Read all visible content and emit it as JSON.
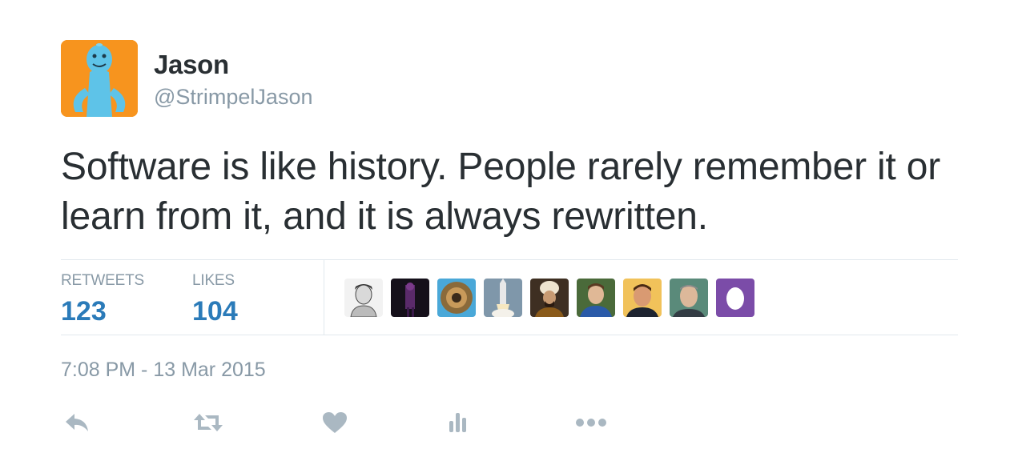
{
  "author": {
    "display_name": "Jason",
    "handle": "@StrimpelJason",
    "avatar_icon": "meeseeks-avatar"
  },
  "tweet": {
    "text": "Software is like history. People rarely remember it or learn from it, and it is always rewritten.",
    "timestamp": "7:08 PM - 13 Mar 2015"
  },
  "stats": {
    "retweets_label": "RETWEETS",
    "retweets_count": "123",
    "likes_label": "LIKES",
    "likes_count": "104"
  },
  "likers": [
    {
      "icon": "sketch-portrait-avatar"
    },
    {
      "icon": "dark-concert-avatar"
    },
    {
      "icon": "fisheye-photo-avatar"
    },
    {
      "icon": "rocket-launch-avatar"
    },
    {
      "icon": "ottoman-portrait-avatar"
    },
    {
      "icon": "man-blue-shirt-avatar"
    },
    {
      "icon": "man-yellow-bg-avatar"
    },
    {
      "icon": "man-outdoor-avatar"
    },
    {
      "icon": "egg-avatar"
    }
  ],
  "actions": [
    "reply-icon",
    "retweet-icon",
    "like-icon",
    "analytics-icon",
    "more-icon"
  ],
  "colors": {
    "text": "#292f33",
    "muted": "#8899a6",
    "accent": "#2b7bb9",
    "action_icon": "#aab8c2",
    "divider": "#e1e8ed",
    "avatar_bg": "#f7941e",
    "egg_bg": "#7b4ca8"
  }
}
